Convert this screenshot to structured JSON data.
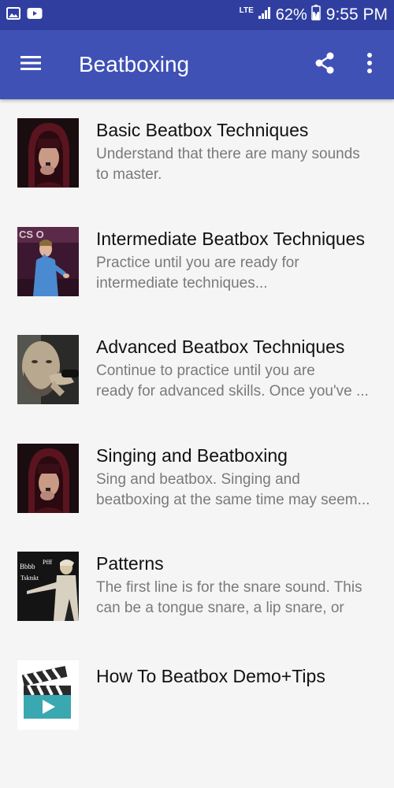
{
  "status_bar": {
    "network": "LTE",
    "battery": "62%",
    "time": "9:55 PM",
    "icons": [
      "image-icon",
      "youtube-icon",
      "signal-icon",
      "battery-icon"
    ]
  },
  "app_bar": {
    "title": "Beatboxing",
    "icons": [
      "menu-icon",
      "share-icon",
      "more-vert-icon"
    ]
  },
  "colors": {
    "status_bar": "#303f9f",
    "app_bar": "#3f51b5",
    "background": "#f5f5f5"
  },
  "items": [
    {
      "title": "Basic Beatbox Techniques",
      "description": "Understand that there are many sounds\nto master.",
      "thumbnail": "hooded-beatboxer-image"
    },
    {
      "title": "Intermediate Beatbox Techniques",
      "description": "Practice until you are ready for\nintermediate techniques...",
      "thumbnail": "stage-beatboxer-image"
    },
    {
      "title": "Advanced Beatbox Techniques",
      "description": "Continue to practice until you are\nready for advanced skills. Once you've ...",
      "thumbnail": "bearded-beatboxer-image"
    },
    {
      "title": "Singing and Beatboxing",
      "description": "Sing and beatbox. Singing and\nbeatboxing at the same time may seem...",
      "thumbnail": "hooded-beatboxer-image"
    },
    {
      "title": "Patterns",
      "description": "The first line is for the snare sound. This\ncan be a tongue snare, a lip snare, or an...",
      "thumbnail": "patterns-image",
      "thumb_text": [
        "Bbbb",
        "Pfff",
        "Tsktskt"
      ]
    },
    {
      "title": "How To Beatbox Demo+Tips",
      "description": "",
      "thumbnail": "video-clapper-image"
    }
  ]
}
